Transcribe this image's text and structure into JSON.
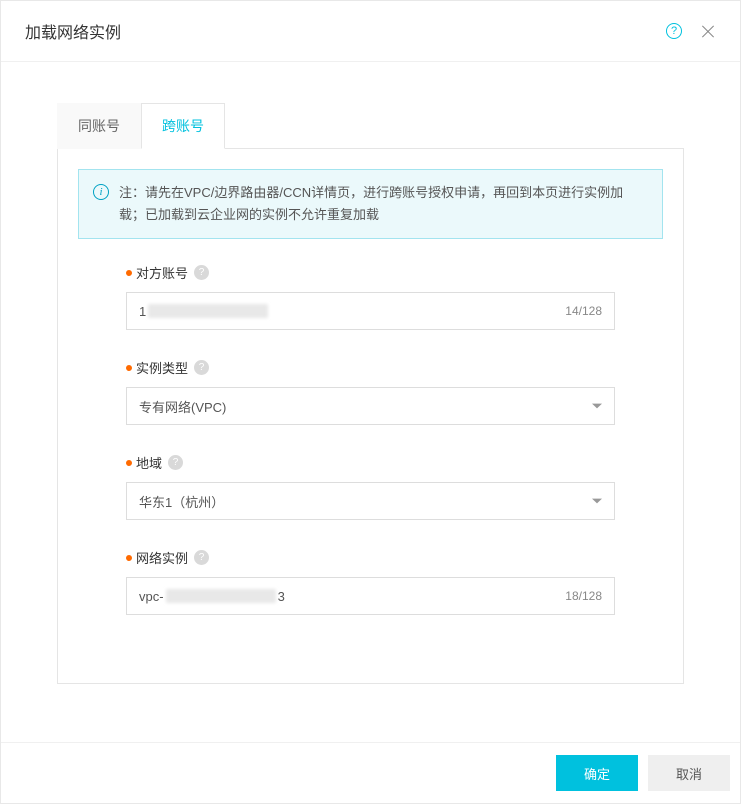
{
  "header": {
    "title": "加载网络实例"
  },
  "tabs": {
    "same_account": "同账号",
    "cross_account": "跨账号"
  },
  "info": {
    "text": "注：请先在VPC/边界路由器/CCN详情页，进行跨账号授权申请，再回到本页进行实例加载；已加载到云企业网的实例不允许重复加载"
  },
  "form": {
    "peer_account": {
      "label": "对方账号",
      "value_prefix": "1",
      "counter": "14/128"
    },
    "instance_type": {
      "label": "实例类型",
      "value": "专有网络(VPC)"
    },
    "region": {
      "label": "地域",
      "value": "华东1（杭州）"
    },
    "network_instance": {
      "label": "网络实例",
      "value_prefix": "vpc-",
      "value_suffix": "3",
      "counter": "18/128"
    }
  },
  "footer": {
    "confirm": "确定",
    "cancel": "取消"
  }
}
